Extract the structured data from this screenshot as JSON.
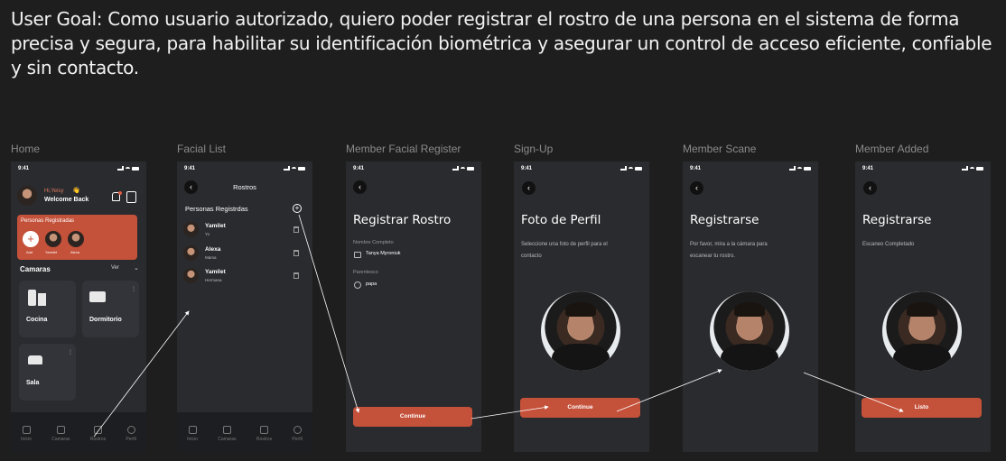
{
  "user_goal": "User Goal: Como usuario autorizado, quiero poder registrar el rostro de una persona en el sistema de forma precisa y segura, para habilitar su identificación biométrica y asegurar un control de acceso eficiente, confiable y sin contacto.",
  "status_time": "9:41",
  "frames": {
    "home": {
      "label": "Home",
      "greeting": "Hi,Yeisy",
      "wave": "👋",
      "welcome": "Welcome Back",
      "card_title": "Personas Registradas",
      "people": [
        {
          "name": "Add"
        },
        {
          "name": "Yamilet"
        },
        {
          "name": "Alexa"
        }
      ],
      "cameras_title": "Camaras",
      "ver_label": "Ver",
      "rooms": [
        {
          "name": "Cocina"
        },
        {
          "name": "Dormitorio"
        },
        {
          "name": "Sala"
        }
      ]
    },
    "facial_list": {
      "label": "Facial List",
      "header": "Rostros",
      "section_title": "Personas Registrdas",
      "items": [
        {
          "name": "Yamilet",
          "relation": "Yo"
        },
        {
          "name": "Alexa",
          "relation": "Mama"
        },
        {
          "name": "Yamilet",
          "relation": "Hermana"
        }
      ]
    },
    "member_register": {
      "label": "Member Facial Register",
      "title": "Registrar Rostro",
      "name_label": "Nombre Completo",
      "name_value": "Tanya Myroniuk",
      "relation_label": "Parentesco",
      "relation_value": "papa",
      "cta": "Continue"
    },
    "signup": {
      "label": "Sign-Up",
      "title": "Foto de Perfil",
      "description": "Seleccione una foto de perfil para el contacto",
      "cta": "Continue"
    },
    "scan": {
      "label": "Member Scane",
      "title": "Registrarse",
      "description": "Por favor, mira a la cámara para escanear tu rostro."
    },
    "added": {
      "label": "Member Added",
      "title": "Registrarse",
      "description": "Escaneo Completado",
      "cta": "Listo"
    }
  },
  "tabbar": [
    "Inicio",
    "Camaras",
    "Rostros",
    "Perfil"
  ],
  "colors": {
    "accent": "#c4513a",
    "background": "#1e1e1e",
    "phone": "#2a2b2f"
  }
}
